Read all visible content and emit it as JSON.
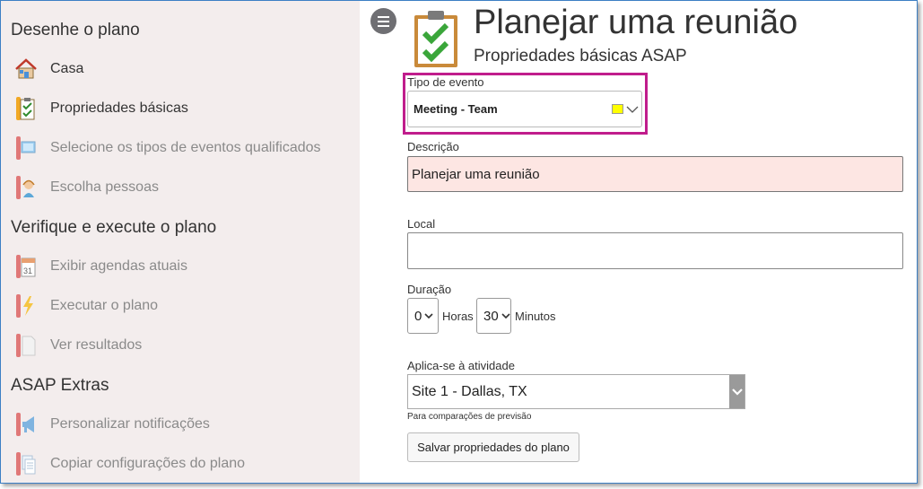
{
  "sidebar": {
    "sections": [
      {
        "title": "Desenhe o plano"
      },
      {
        "title": "Verifique e execute o plano"
      },
      {
        "title": "ASAP Extras"
      }
    ],
    "items": [
      {
        "label": "Casa",
        "icon": "house-icon",
        "enabled": true
      },
      {
        "label": "Propriedades básicas",
        "icon": "clipboard-check-icon",
        "enabled": true
      },
      {
        "label": "Selecione os tipos de eventos qualificados",
        "icon": "monitor-icon",
        "enabled": false
      },
      {
        "label": "Escolha pessoas",
        "icon": "person-headset-icon",
        "enabled": false
      },
      {
        "label": "Exibir agendas atuais",
        "icon": "calendar-icon",
        "enabled": false
      },
      {
        "label": "Executar o plano",
        "icon": "lightning-icon",
        "enabled": false
      },
      {
        "label": "Ver resultados",
        "icon": "document-icon",
        "enabled": false
      },
      {
        "label": "Personalizar notificações",
        "icon": "megaphone-icon",
        "enabled": false
      },
      {
        "label": "Copiar configurações do plano",
        "icon": "copy-document-icon",
        "enabled": false
      }
    ]
  },
  "header": {
    "title": "Planejar uma reunião",
    "subtitle": "Propriedades básicas ASAP"
  },
  "form": {
    "event_type": {
      "label": "Tipo de evento",
      "value": "Meeting - Team",
      "swatch_color": "#ffff00"
    },
    "description": {
      "label": "Descrição",
      "value": "Planejar uma reunião"
    },
    "location": {
      "label": "Local",
      "value": ""
    },
    "duration": {
      "label": "Duração",
      "hours_value": "0",
      "hours_label": "Horas",
      "minutes_value": "30",
      "minutes_label": "Minutos"
    },
    "activity": {
      "label": "Aplica-se à atividade",
      "value": "Site 1 - Dallas, TX",
      "hint": "Para comparações de previsão"
    },
    "save_label": "Salvar propriedades do plano"
  },
  "colors": {
    "sidebar_bg": "#f3eded",
    "highlight": "#c01d8c",
    "error_bg": "#fde6e3",
    "frame_border": "#3c7fc4"
  }
}
